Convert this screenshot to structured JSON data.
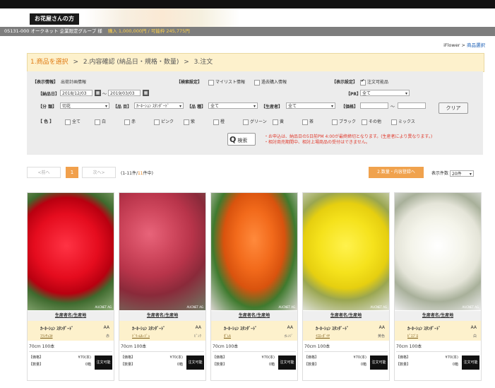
{
  "header": {
    "badge": "お花屋さんの方",
    "member_code": "05131-000",
    "member_name": "オークネット 企業限定グループ 様",
    "purchase_info": "購入 1,000,000円 / 可能枠 245,775円"
  },
  "breadcrumb": {
    "home": "iFlower",
    "sep": ">",
    "current": "商品選択"
  },
  "steps": [
    {
      "label": "1.商品を選択",
      "active": true
    },
    {
      "label": ">"
    },
    {
      "label": "2.内容確認 (納品日・規格・数量)"
    },
    {
      "label": ">"
    },
    {
      "label": "3.注文"
    }
  ],
  "filter": {
    "display_info_label": "【表示情報】",
    "display_info_value": "出荷計画情報",
    "search_setting_label": "【検索設定】",
    "mylist_label": "マイリスト情報",
    "past_label": "過去購入情報",
    "display_setting_label": "【表示設定】",
    "orderable_label": "注文可能品",
    "delivery_label": "【納品日】",
    "date_from": "2018/12/03",
    "date_sep": "～",
    "date_to": "2019/03/03",
    "pr_label": "【PR】",
    "pr_value": "全て",
    "category_label": "【分 類】",
    "category_value": "切花",
    "item_label": "【品 目】",
    "item_value": "ｶｰﾈｰｼｮﾝ ｽﾀﾝﾀﾞｰﾄﾞ",
    "variety_label": "【品 種】",
    "variety_value": "全て",
    "producer_label": "【生産者】",
    "producer_value": "全て",
    "price_label": "【価格】",
    "price_sep": "～",
    "clear_label": "クリア",
    "color_label": "【 色 】",
    "colors": [
      "全て",
      "白",
      "赤",
      "ピンク",
      "紫",
      "橙",
      "グリーン",
      "黄",
      "茶",
      "ブラック",
      "その他",
      "ミックス"
    ],
    "search_label": "検索",
    "notes": [
      "・お申込は、納品日の5日前PM 4:00が最終締切となります。(生産者により異なります。)",
      "・相対商売期間中、相対上場商品の受付はできません。"
    ]
  },
  "pager": {
    "prev": "<前へ",
    "page": "1",
    "next": "次へ>",
    "count_prefix": "(1-11件/",
    "count_num": "11",
    "count_suffix": "件中)"
  },
  "to_cart_label": "2.数量・内容登録へ",
  "per_page": {
    "label": "表示件数",
    "value": "20件"
  },
  "products": [
    {
      "producer": "生産者名/生産地",
      "name": "ｶｰﾈｰｼｮﾝ ｽﾀﾝﾀﾞｰﾄﾞ",
      "grade": "AA",
      "variety": "ﾌﾗﾝﾁｪｽｶ",
      "color_name": "赤",
      "size": "70cm 100本",
      "price_label": "【価格】",
      "price": "¥70(本)",
      "qty_label": "【数量】",
      "qty": "0箱",
      "order_label": "注文可能",
      "photo": "red"
    },
    {
      "producer": "生産者名/生産地",
      "name": "ｶｰﾈｰｼｮﾝ ｽﾀﾝﾀﾞｰﾄﾞ",
      "grade": "AA",
      "variety": "ﾄﾞﾘｰﾑﾙｰｼﾞｭ",
      "color_name": "ﾋﾟﾝｸ",
      "size": "70cm 100本",
      "price_label": "【価格】",
      "price": "¥70(本)",
      "qty_label": "【数量】",
      "qty": "0箱",
      "order_label": "注文可能",
      "photo": "pink"
    },
    {
      "producer": "生産者名/生産地",
      "name": "ｶｰﾈｰｼｮﾝ ｽﾀﾝﾀﾞｰﾄﾞ",
      "grade": "AA",
      "variety": "ﾀﾞﾚﾙ",
      "color_name": "ｵﾚﾝｼﾞ",
      "size": "70cm 100本",
      "price_label": "【価格】",
      "price": "¥70(本)",
      "qty_label": "【数量】",
      "qty": "0箱",
      "order_label": "注文可能",
      "photo": "orange"
    },
    {
      "producer": "生産者名/生産地",
      "name": "ｶｰﾈｰｼｮﾝ ｽﾀﾝﾀﾞｰﾄﾞ",
      "grade": "AA",
      "variety": "ｲｴﾛｰﾀﾞｲﾔ",
      "color_name": "黄色",
      "size": "70cm 100本",
      "price_label": "【価格】",
      "price": "¥70(本)",
      "qty_label": "【数量】",
      "qty": "0箱",
      "order_label": "注文可能",
      "photo": "yellow"
    },
    {
      "producer": "生産者名/生産地",
      "name": "ｶｰﾈｰｼｮﾝ ｽﾀﾝﾀﾞｰﾄﾞ",
      "grade": "AA",
      "variety": "ﾋﾟｴﾌﾞﾛ",
      "color_name": "白",
      "size": "70cm 100本",
      "price_label": "【価格】",
      "price": "¥70(本)",
      "qty_label": "【数量】",
      "qty": "0箱",
      "order_label": "注文可能",
      "photo": "white"
    }
  ],
  "watermark": "AUCNET AG",
  "colors": {
    "accent": "#f0a24d",
    "step_bg": "#fdf1cc",
    "note_red": "#e03a2d",
    "header_dark": "#111111"
  }
}
